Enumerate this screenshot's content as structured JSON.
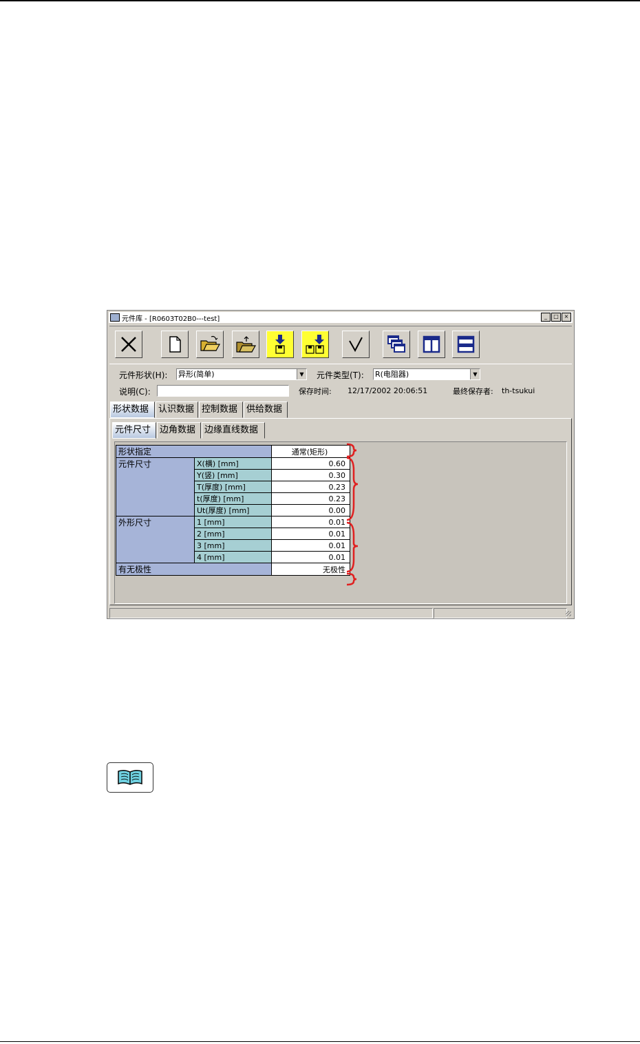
{
  "window": {
    "title": "元件库 - [R0603T02B0---test]",
    "minimize_label": "_",
    "maximize_label": "□",
    "close_label": "×"
  },
  "toolbar": {
    "buttons": [
      {
        "name": "close-library-button",
        "icon": "x-icon"
      },
      {
        "name": "new-file-button",
        "icon": "blank-document-icon"
      },
      {
        "name": "open-folder-button",
        "icon": "open-folder-icon"
      },
      {
        "name": "open-folder-alt-button",
        "icon": "folder-upload-icon"
      },
      {
        "name": "save-button",
        "icon": "save-download-icon",
        "color": "#ffff33"
      },
      {
        "name": "save-all-button",
        "icon": "save-all-icon",
        "color": "#ffff33"
      },
      {
        "name": "check-button",
        "icon": "checkmark-icon"
      },
      {
        "name": "cascade-windows-button",
        "icon": "cascade-icon"
      },
      {
        "name": "tile-vertical-button",
        "icon": "tile-vertical-icon"
      },
      {
        "name": "tile-horizontal-button",
        "icon": "tile-horizontal-icon"
      }
    ]
  },
  "form": {
    "shape_label": "元件形状(H):",
    "shape_value": "异形(简单)",
    "type_label": "元件类型(T):",
    "type_value": "R(电阻器)",
    "desc_label": "说明(C):",
    "desc_value": "",
    "saved_time_label": "保存时间:",
    "saved_time_value": "12/17/2002 20:06:51",
    "last_saver_label": "最终保存者:",
    "last_saver_value": "th-tsukui"
  },
  "tabs": [
    "形状数据",
    "认识数据",
    "控制数据",
    "供给数据"
  ],
  "subtabs": [
    "元件尺寸",
    "边角数据",
    "边缘直线数据"
  ],
  "grid": {
    "shape_spec_label": "形状指定",
    "shape_spec_value": "通常(矩形)",
    "component_size_label": "元件尺寸",
    "component_size_rows": [
      {
        "label": "X(横) [mm]",
        "value": "0.60"
      },
      {
        "label": "Y(竖) [mm]",
        "value": "0.30"
      },
      {
        "label": "T(厚度) [mm]",
        "value": "0.23"
      },
      {
        "label": "t(厚度) [mm]",
        "value": "0.23"
      },
      {
        "label": "Ut(厚度) [mm]",
        "value": "0.00"
      }
    ],
    "outline_size_label": "外形尺寸",
    "outline_size_rows": [
      {
        "label": "1 [mm]",
        "value": "0.01"
      },
      {
        "label": "2 [mm]",
        "value": "0.01"
      },
      {
        "label": "3 [mm]",
        "value": "0.01"
      },
      {
        "label": "4 [mm]",
        "value": "0.01"
      }
    ],
    "polarity_label": "有无极性",
    "polarity_value": "无极性"
  },
  "colors": {
    "annotation_brace": "#e02020",
    "header_cell": "#a6b4d8",
    "subheader_cell": "#a6cfd3",
    "toolbar_highlight": "#ffff33",
    "icon_blue": "#1a2a8a"
  },
  "reference_icon": "book-icon"
}
